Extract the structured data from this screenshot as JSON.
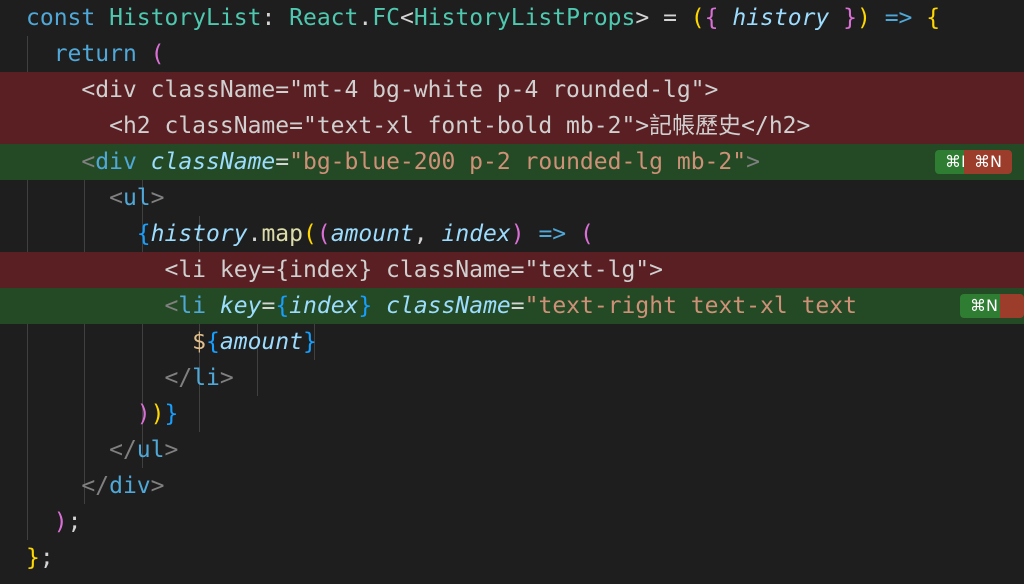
{
  "lines": [
    {
      "tokens": [
        "const",
        "HistoryList",
        ": ",
        "React",
        ".",
        "FC",
        "<",
        "HistoryListProps",
        ">",
        " = ",
        "(",
        "{",
        " history ",
        "}",
        ")",
        " => ",
        "{"
      ]
    },
    {
      "tokens": [
        "return",
        " ",
        "("
      ]
    },
    {
      "tokens": [
        "<div className=\"mt-4 bg-white p-4 rounded-lg\">"
      ]
    },
    {
      "tokens": [
        "<h2 className=\"text-xl font-bold mb-2\">記帳歷史</h2>"
      ]
    },
    {
      "tokens": [
        "<",
        "div",
        " ",
        "className",
        "=",
        "\"bg-blue-200 p-2 rounded-lg mb-2\"",
        ">"
      ]
    },
    {
      "tokens": [
        "<",
        "ul",
        ">"
      ]
    },
    {
      "tokens": [
        "{",
        "history",
        ".",
        "map",
        "(",
        "(",
        "amount",
        ", ",
        "index",
        ")",
        " => ",
        "("
      ]
    },
    {
      "tokens": [
        "<li key={index} className=\"text-lg\">"
      ]
    },
    {
      "tokens": [
        "<",
        "li",
        " ",
        "key",
        "=",
        "{",
        "index",
        "}",
        " ",
        "className",
        "=",
        "\"text-right text-xl text"
      ]
    },
    {
      "tokens": [
        "$",
        "{",
        "amount",
        "}"
      ]
    },
    {
      "tokens": [
        "</",
        "li",
        ">"
      ]
    },
    {
      "tokens": [
        ")",
        ")",
        "}"
      ]
    },
    {
      "tokens": [
        "</",
        "ul",
        ">"
      ]
    },
    {
      "tokens": [
        "</",
        "div",
        ">"
      ]
    },
    {
      "tokens": [
        ")",
        ";"
      ]
    },
    {
      "tokens": [
        "}",
        ";"
      ]
    }
  ],
  "badges": {
    "accept_label": "⌘N",
    "reject_label": "⌘N"
  },
  "colors": {
    "background": "#1e1e1e",
    "removed_line": "#5a1f22",
    "added_line": "#244a25",
    "accept_badge": "#2e7d32",
    "reject_badge": "#9c3d2b"
  }
}
